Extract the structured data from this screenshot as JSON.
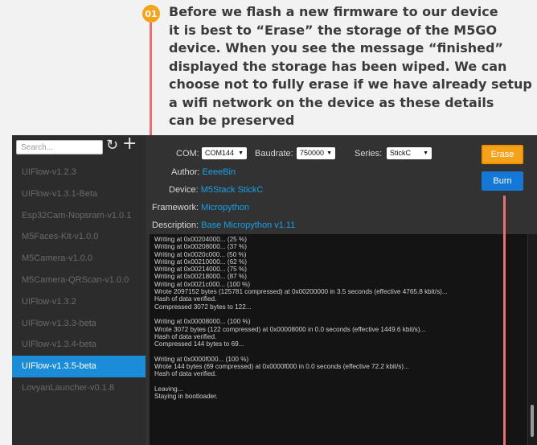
{
  "callout": {
    "badge": "01",
    "lines": [
      "Before we flash a new firmware to our device",
      "it is best to “Erase” the storage of the M5GO",
      "device. When you see the message “finished”",
      "displayed the storage has been wiped. We can",
      "choose not to fully erase if we have already setup",
      "a wifi network on the device as these details",
      "can be preserved"
    ]
  },
  "sidebar": {
    "search_placeholder": "Search...",
    "refresh_icon": "refresh-icon",
    "add_icon": "add-icon",
    "items": [
      "UIFlow-v1.2.3",
      "UIFlow-v1.3.1-Beta",
      "Esp32Cam-Nopsram-v1.0.1",
      "M5Faces-Kit-v1.0.0",
      "M5Camera-v1.0.0",
      "M5Camera-QRScan-v1.0.0",
      "UIFlow-v1.3.2",
      "UIFlow-v1.3.3-beta",
      "UIFlow-v1.3.4-beta",
      "UIFlow-v1.3.5-beta",
      "LovyanLauncher-v0.1.8"
    ],
    "active_index": 9
  },
  "settings": {
    "com_label": "COM:",
    "com_value": "COM144",
    "baudrate_label": "Baudrate:",
    "baudrate_value": "750000",
    "series_label": "Series:",
    "series_value": "StickC",
    "author_label": "Author:",
    "author_value": "EeeeBin",
    "device_label": "Device:",
    "device_value": "M5Stack StickC",
    "framework_label": "Framework:",
    "framework_value": "Micropython",
    "description_label": "Description:",
    "description_value": "Base Micropython v1.11"
  },
  "buttons": {
    "erase": "Erase",
    "burn": "Burn"
  },
  "console": {
    "lines": [
      "Writing at 0x00204000... (25 %)",
      "Writing at 0x00208000... (37 %)",
      "Writing at 0x0020c000... (50 %)",
      "Writing at 0x00210000... (62 %)",
      "Writing at 0x00214000... (75 %)",
      "Writing at 0x00218000... (87 %)",
      "Writing at 0x0021c000... (100 %)",
      "Wrote 2097152 bytes (125781 compressed) at 0x00200000 in 3.5 seconds (effective 4765.8 kbit/s)...",
      "Hash of data verified.",
      "Compressed 3072 bytes to 122...",
      "",
      "Writing at 0x00008000... (100 %)",
      "Wrote 3072 bytes (122 compressed) at 0x00008000 in 0.0 seconds (effective 1449.6 kbit/s)...",
      "Hash of data verified.",
      "Compressed 144 bytes to 69...",
      "",
      "Writing at 0x0000f000... (100 %)",
      "Wrote 144 bytes (69 compressed) at 0x0000f000 in 0.0 seconds (effective 72.2 kbit/s)...",
      "Hash of data verified.",
      "",
      "Leaving...",
      "Staying in bootloader."
    ]
  },
  "colors": {
    "accent": "#1a8cd8",
    "erase": "#f5a21a",
    "burn": "#1577d6",
    "pointer": "#e57373",
    "badge": "#f4a31a"
  }
}
